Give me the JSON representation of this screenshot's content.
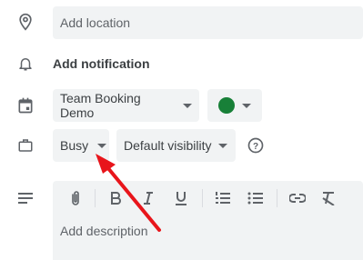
{
  "location": {
    "placeholder": "Add location"
  },
  "notification": {
    "label": "Add notification"
  },
  "calendar": {
    "selected": "Team Booking Demo",
    "color": "#188038"
  },
  "status": {
    "busy": "Busy",
    "visibility": "Default visibility"
  },
  "description": {
    "placeholder": "Add description"
  },
  "annotation": {
    "arrow_color": "#e8151b"
  }
}
